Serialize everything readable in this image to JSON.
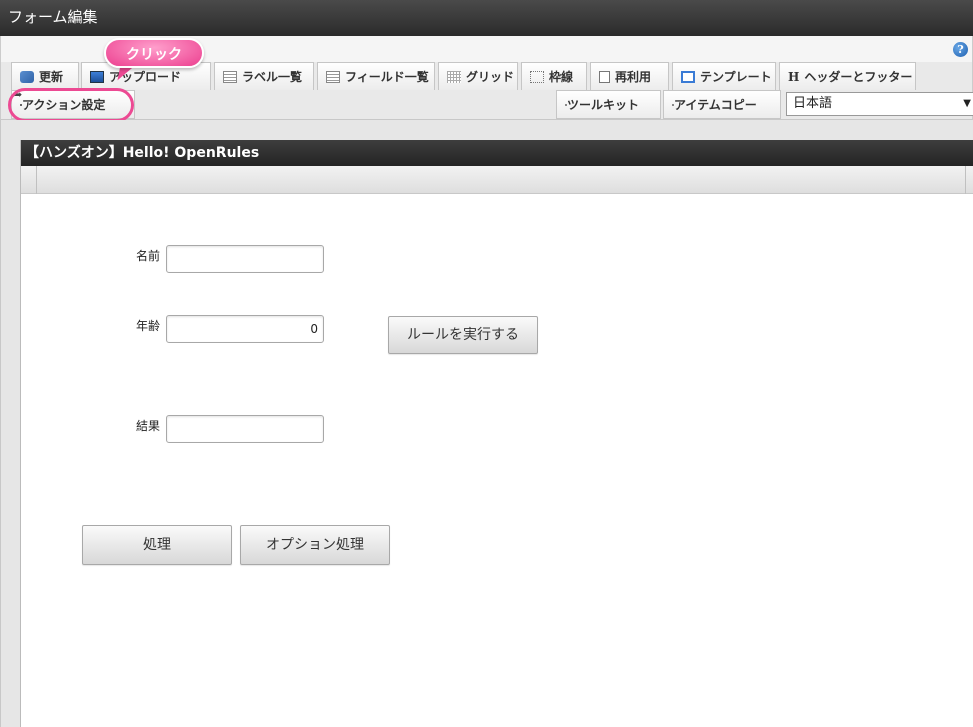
{
  "window": {
    "title": "フォーム編集"
  },
  "help": {
    "glyph": "?"
  },
  "tabs": [
    {
      "label": "更新",
      "icon": "refresh-icon"
    },
    {
      "label": "アップロード",
      "icon": "download-icon"
    },
    {
      "label": "ラベル一覧",
      "icon": "list-icon"
    },
    {
      "label": "フィールド一覧",
      "icon": "list-icon"
    },
    {
      "label": "グリッド",
      "icon": "grid-icon"
    },
    {
      "label": "枠線",
      "icon": "frame-icon"
    },
    {
      "label": "再利用",
      "icon": "document-icon"
    },
    {
      "label": "テンプレート",
      "icon": "template-icon"
    },
    {
      "label": "ヘッダーとフッター",
      "icon": "header-icon"
    }
  ],
  "row2": {
    "action": "アクション設定",
    "toolkit": "ツールキット",
    "itemcopy": "アイテムコピー"
  },
  "language": {
    "selected": "日本語",
    "arrow": "▼"
  },
  "header_glyph": "H",
  "callout": {
    "text": "クリック"
  },
  "form": {
    "title": "【ハンズオン】Hello! OpenRules",
    "name_label": "名前",
    "name_value": "",
    "age_label": "年齢",
    "age_value": "0",
    "result_label": "結果",
    "result_value": "",
    "run_button": "ルールを実行する",
    "process_button": "処理",
    "option_button": "オプション処理"
  },
  "colors": {
    "accent": "#ec4a93",
    "titlebar": "#333333",
    "help": "#1d5fb0"
  }
}
